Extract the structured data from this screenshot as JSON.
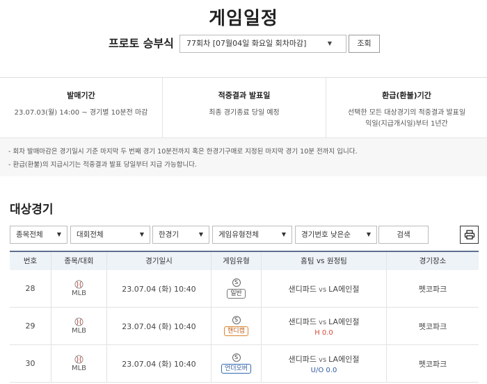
{
  "page": {
    "title": "게임일정"
  },
  "round": {
    "label": "프로토 승부식",
    "selected": "77회차 [07월04일 화요일 회차마감]",
    "search_label": "조회"
  },
  "info": {
    "cols": [
      {
        "heading": "발매기간",
        "body": [
          "23.07.03(월) 14:00 ~ 경기별 10분전 마감"
        ]
      },
      {
        "heading": "적중결과 발표일",
        "body": [
          "최종 경기종료 당일 예정"
        ]
      },
      {
        "heading": "환급(환불)기간",
        "body": [
          "선택한 모든 대상경기의 적중결과 발표일",
          "익일(지급개시일)부터 1년간"
        ]
      }
    ],
    "notes": [
      "- 회차 발매마감은 경기일시 기준 마지막 두 번째 경기 10분전까지 혹은 한경기구매로 지정된 마지막 경기 10분 전까지 입니다.",
      "- 환급(환불)의 지급시기는 적중결과 발표 당일부터 지급 가능합니다."
    ]
  },
  "section": {
    "title": "대상경기"
  },
  "filters": {
    "sport": "종목전체",
    "league": "대회전체",
    "game_count": "한경기",
    "game_type": "게임유형전체",
    "sort": "경기번호 낮은순",
    "search_label": "검색"
  },
  "table": {
    "headers": [
      "번호",
      "종목/대회",
      "경기일시",
      "게임유형",
      "홈팀 vs 원정팀",
      "경기장소"
    ],
    "rows": [
      {
        "no": "28",
        "league": "MLB",
        "datetime": "23.07.04 (화) 10:40",
        "s": "S",
        "type": "일반",
        "home": "샌디파드",
        "vs": "vs",
        "away": "LA에인절",
        "line": "",
        "venue": "펫코파크"
      },
      {
        "no": "29",
        "league": "MLB",
        "datetime": "23.07.04 (화) 10:40",
        "s": "S",
        "type": "핸디캡",
        "home": "샌디파드",
        "vs": "vs",
        "away": "LA에인절",
        "line": "H 0.0",
        "venue": "펫코파크"
      },
      {
        "no": "30",
        "league": "MLB",
        "datetime": "23.07.04 (화) 10:40",
        "s": "S",
        "type": "언더오버",
        "home": "샌디파드",
        "vs": "vs",
        "away": "LA에인절",
        "line": "U/O 0.0",
        "venue": "펫코파크"
      }
    ]
  }
}
